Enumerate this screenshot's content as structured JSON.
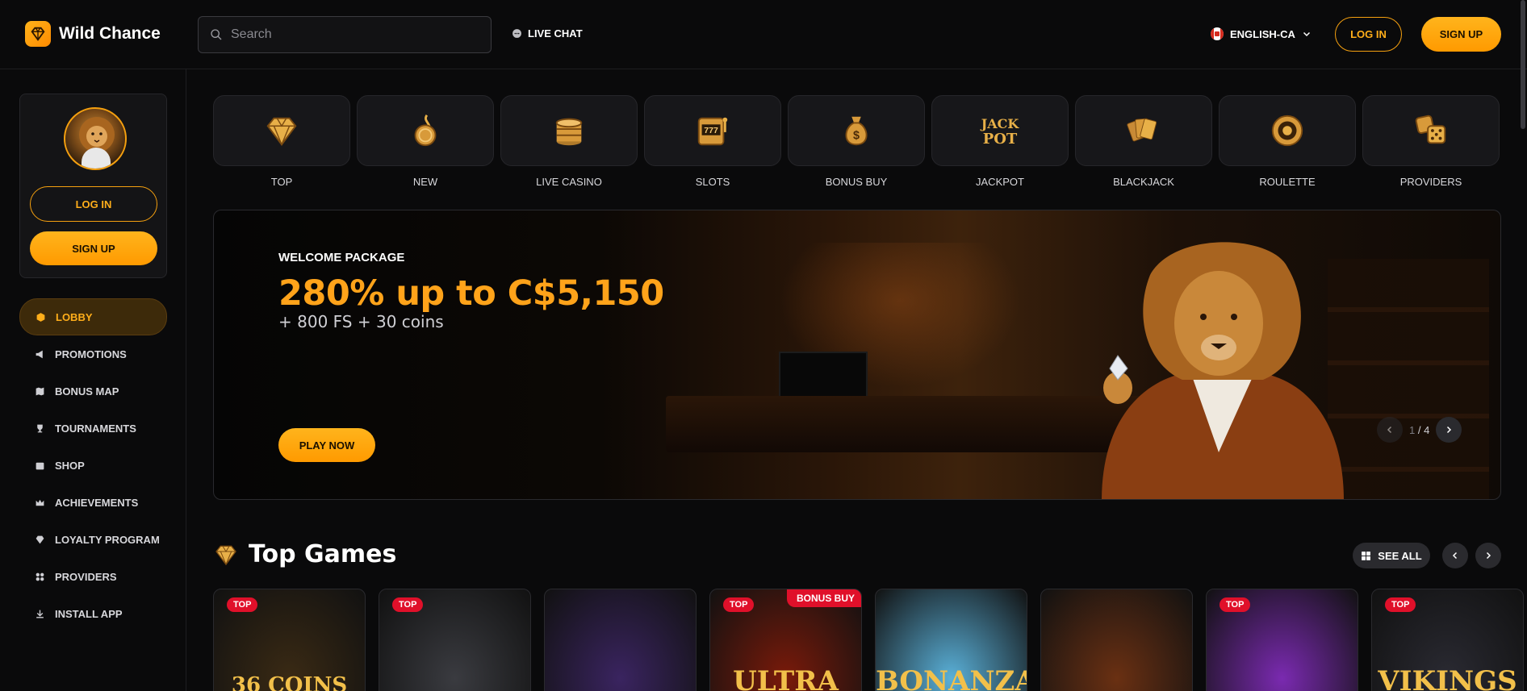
{
  "header": {
    "brand": "Wild Chance",
    "search_placeholder": "Search",
    "live_chat": "LIVE CHAT",
    "language": "ENGLISH-CA",
    "login": "LOG IN",
    "signup": "SIGN UP"
  },
  "sidebar": {
    "login": "LOG IN",
    "signup": "SIGN UP",
    "items": [
      {
        "label": "LOBBY",
        "icon": "cube-icon"
      },
      {
        "label": "PROMOTIONS",
        "icon": "megaphone-icon"
      },
      {
        "label": "BONUS MAP",
        "icon": "map-icon"
      },
      {
        "label": "TOURNAMENTS",
        "icon": "trophy-icon"
      },
      {
        "label": "SHOP",
        "icon": "shop-icon"
      },
      {
        "label": "ACHIEVEMENTS",
        "icon": "crown-icon"
      },
      {
        "label": "LOYALTY PROGRAM",
        "icon": "diamond-icon"
      },
      {
        "label": "PROVIDERS",
        "icon": "grid-icon"
      },
      {
        "label": "INSTALL APP",
        "icon": "download-icon"
      }
    ]
  },
  "categories": [
    {
      "label": "TOP",
      "icon": "diamond-icon"
    },
    {
      "label": "NEW",
      "icon": "coin-flame-icon"
    },
    {
      "label": "LIVE CASINO",
      "icon": "chips-icon"
    },
    {
      "label": "SLOTS",
      "icon": "slot-machine-icon"
    },
    {
      "label": "BONUS BUY",
      "icon": "money-bag-icon"
    },
    {
      "label": "JACKPOT",
      "icon": "jackpot-icon"
    },
    {
      "label": "BLACKJACK",
      "icon": "cards-icon"
    },
    {
      "label": "ROULETTE",
      "icon": "roulette-icon"
    },
    {
      "label": "PROVIDERS",
      "icon": "dice-icon"
    }
  ],
  "banner": {
    "subtitle": "WELCOME PACKAGE",
    "title": "280% up to C$5,150",
    "extra": "+ 800 FS + 30 coins",
    "cta": "PLAY NOW",
    "page_current": "1",
    "page_sep": "/",
    "page_total": "4"
  },
  "top_games": {
    "title": "Top Games",
    "see_all": "SEE ALL",
    "games": [
      {
        "badge": "TOP",
        "bonus": "",
        "art": "36 COINS",
        "bg": "#3a2a14"
      },
      {
        "badge": "TOP",
        "bonus": "",
        "art": "",
        "bg": "#3a3b40"
      },
      {
        "badge": "",
        "bonus": "",
        "art": "",
        "bg": "#3a2460"
      },
      {
        "badge": "TOP",
        "bonus": "BONUS BUY",
        "art": "ULTRA",
        "bg": "#7a1a0a"
      },
      {
        "badge": "",
        "bonus": "",
        "art": "BONANZA",
        "bg": "#5ab0d8"
      },
      {
        "badge": "",
        "bonus": "",
        "art": "",
        "bg": "#6a3012"
      },
      {
        "badge": "TOP",
        "bonus": "",
        "art": "",
        "bg": "#7a2ab0"
      },
      {
        "badge": "TOP",
        "bonus": "",
        "art": "VIKINGS",
        "bg": "#2a2a32"
      }
    ]
  },
  "colors": {
    "accent": "#ffa31a",
    "badge": "#e0102a",
    "background": "#0a0a0b"
  }
}
